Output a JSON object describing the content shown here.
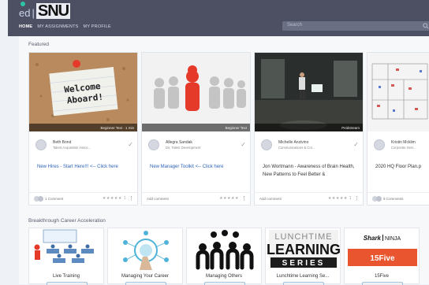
{
  "header": {
    "logo_ed": "ed",
    "logo_sep": "|",
    "logo_snu": "SNU",
    "nav": [
      "HOME",
      "MY ASSIGNMENTS",
      "MY PROFILE"
    ],
    "search_placeholder": "Search"
  },
  "featured": {
    "heading": "Featured",
    "cards": [
      {
        "tag": "Beginner Text   · 1 min",
        "name": "Beth Bond",
        "role": "Talent Acquisition Assoc...",
        "title": "New Hires - Start Here!!! <-- Click here",
        "link": true,
        "footer": "1 Comment",
        "stars": "★★★★★ 1",
        "thumb_text": "Welcome Aboard!"
      },
      {
        "tag": "Beginner Text",
        "name": "Allegra Sandak",
        "role": "Dir, Talent Development",
        "title": "New Manager Toolkit <-- Click here",
        "link": true,
        "footer": "Add comment",
        "stars": "★★★★★"
      },
      {
        "tag": "Peidstream",
        "name": "Michelle Anzivino",
        "role": "Communications & Cor...",
        "title": "Jon Wortmann - Awareness of Brain Health, New Patterns to Feel Better &",
        "link": false,
        "footer": "Add comment",
        "stars": "★★★★★ 1"
      },
      {
        "tag": "",
        "name": "Kristin Mcklim",
        "role": "Corporate Serv...",
        "title": "2020 HQ Floor Plan.p",
        "link": false,
        "footer": "9 Comments",
        "stars": ""
      }
    ]
  },
  "career": {
    "heading": "Breakthrough Career Acceleration",
    "tiles": [
      {
        "label": "Live Training"
      },
      {
        "label": "Managing Your Career"
      },
      {
        "label": "Managing Others"
      },
      {
        "label": "Lunchtime Learning Se...",
        "art_lines": [
          "LUNCHTIME",
          "LEARNING",
          "SERIES"
        ]
      },
      {
        "label": "15Five",
        "art_brand": "Shark",
        "art_brand2": "NINJA",
        "art_product": "15Five"
      }
    ]
  },
  "colors": {
    "topbar": "#4d5063",
    "link": "#2f63b8",
    "accent_red": "#e53a2a"
  }
}
